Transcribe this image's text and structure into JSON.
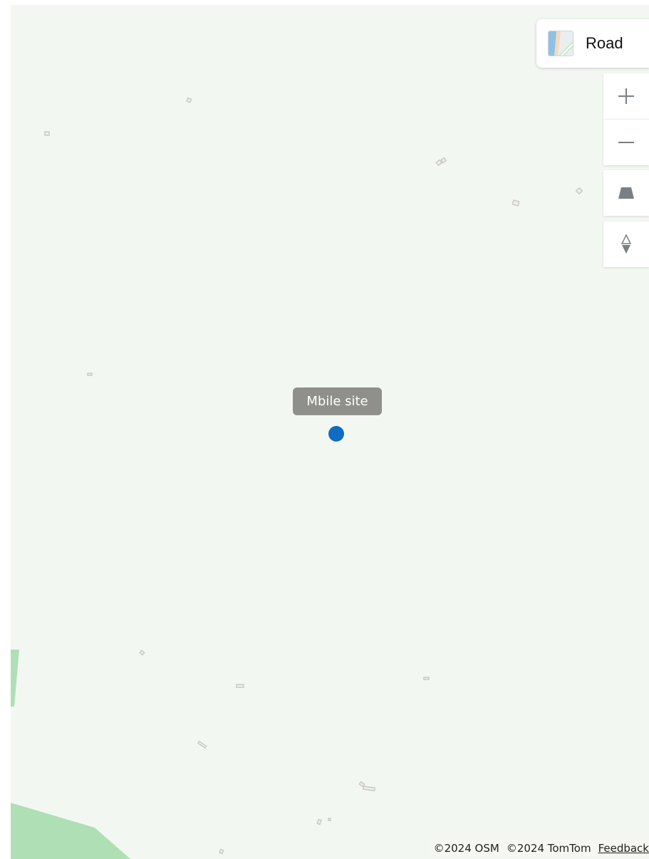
{
  "map": {
    "style_picker": {
      "label": "Road",
      "icon": "road-style-thumbnail-icon"
    },
    "controls": {
      "zoom_in": {
        "icon": "plus-icon"
      },
      "zoom_out": {
        "icon": "minus-icon"
      },
      "pitch": {
        "icon": "pitch-trapezoid-icon"
      },
      "compass": {
        "icon": "compass-diamond-icon"
      }
    },
    "marker": {
      "label": "Mbile site",
      "color": "#0f6cc3"
    },
    "attribution": {
      "osm": "©2024 OSM",
      "tomtom": "©2024 TomTom",
      "feedback": "Feedback"
    },
    "colors": {
      "background": "#f3f7f2",
      "park": "#afdfb5",
      "building": "#cfcfcf",
      "control_icon": "#7a7f84"
    }
  }
}
